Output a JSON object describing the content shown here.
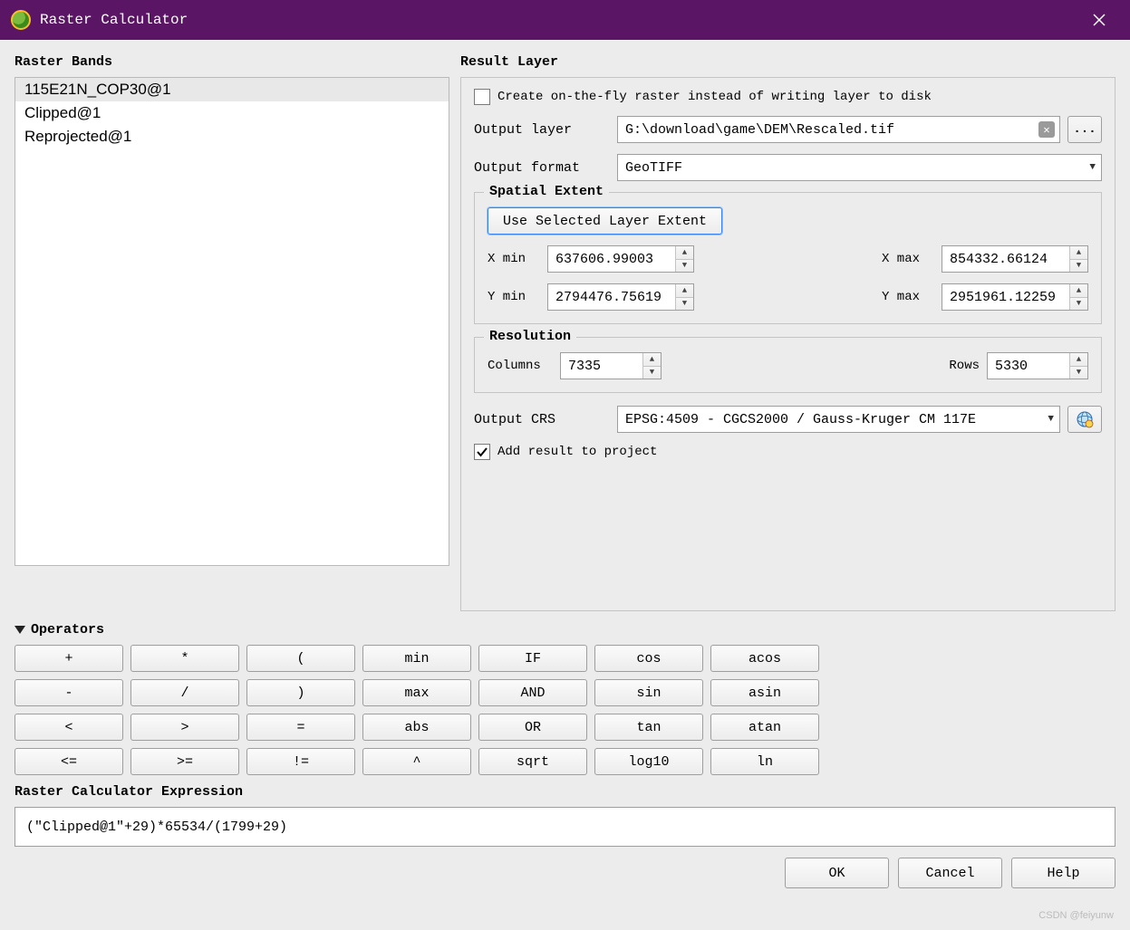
{
  "window": {
    "title": "Raster Calculator"
  },
  "raster_bands": {
    "title": "Raster Bands",
    "items": [
      "115E21N_COP30@1",
      "Clipped@1",
      "Reprojected@1"
    ],
    "selected_index": 0
  },
  "result_layer": {
    "title": "Result Layer",
    "create_on_fly": {
      "label": "Create on-the-fly raster instead of writing layer to disk",
      "checked": false
    },
    "output_layer": {
      "label": "Output layer",
      "value": "G:\\download\\game\\DEM\\Rescaled.tif"
    },
    "output_format": {
      "label": "Output format",
      "value": "GeoTIFF"
    },
    "browse_btn": "...",
    "spatial_extent": {
      "title": "Spatial Extent",
      "use_selected_button": "Use Selected Layer Extent",
      "xmin": {
        "label": "X min",
        "value": "637606.99003"
      },
      "xmax": {
        "label": "X max",
        "value": "854332.66124"
      },
      "ymin": {
        "label": "Y min",
        "value": "2794476.75619"
      },
      "ymax": {
        "label": "Y max",
        "value": "2951961.12259"
      }
    },
    "resolution": {
      "title": "Resolution",
      "columns": {
        "label": "Columns",
        "value": "7335"
      },
      "rows": {
        "label": "Rows",
        "value": "5330"
      }
    },
    "output_crs": {
      "label": "Output CRS",
      "value": "EPSG:4509 - CGCS2000 / Gauss-Kruger CM 117E"
    },
    "add_result": {
      "label": "Add result to project",
      "checked": true
    }
  },
  "operators": {
    "title": "Operators",
    "buttons": [
      "+",
      "*",
      "(",
      "min",
      "IF",
      "cos",
      "acos",
      "-",
      "/",
      ")",
      "max",
      "AND",
      "sin",
      "asin",
      "<",
      ">",
      "=",
      "abs",
      "OR",
      "tan",
      "atan",
      "<=",
      ">=",
      "!=",
      "^",
      "sqrt",
      "log10",
      "ln"
    ]
  },
  "expression": {
    "title": "Raster Calculator Expression",
    "value": "(\"Clipped@1\"+29)*65534/(1799+29)"
  },
  "buttons": {
    "ok": "OK",
    "cancel": "Cancel",
    "help": "Help"
  },
  "watermark": "CSDN @feiyunw"
}
